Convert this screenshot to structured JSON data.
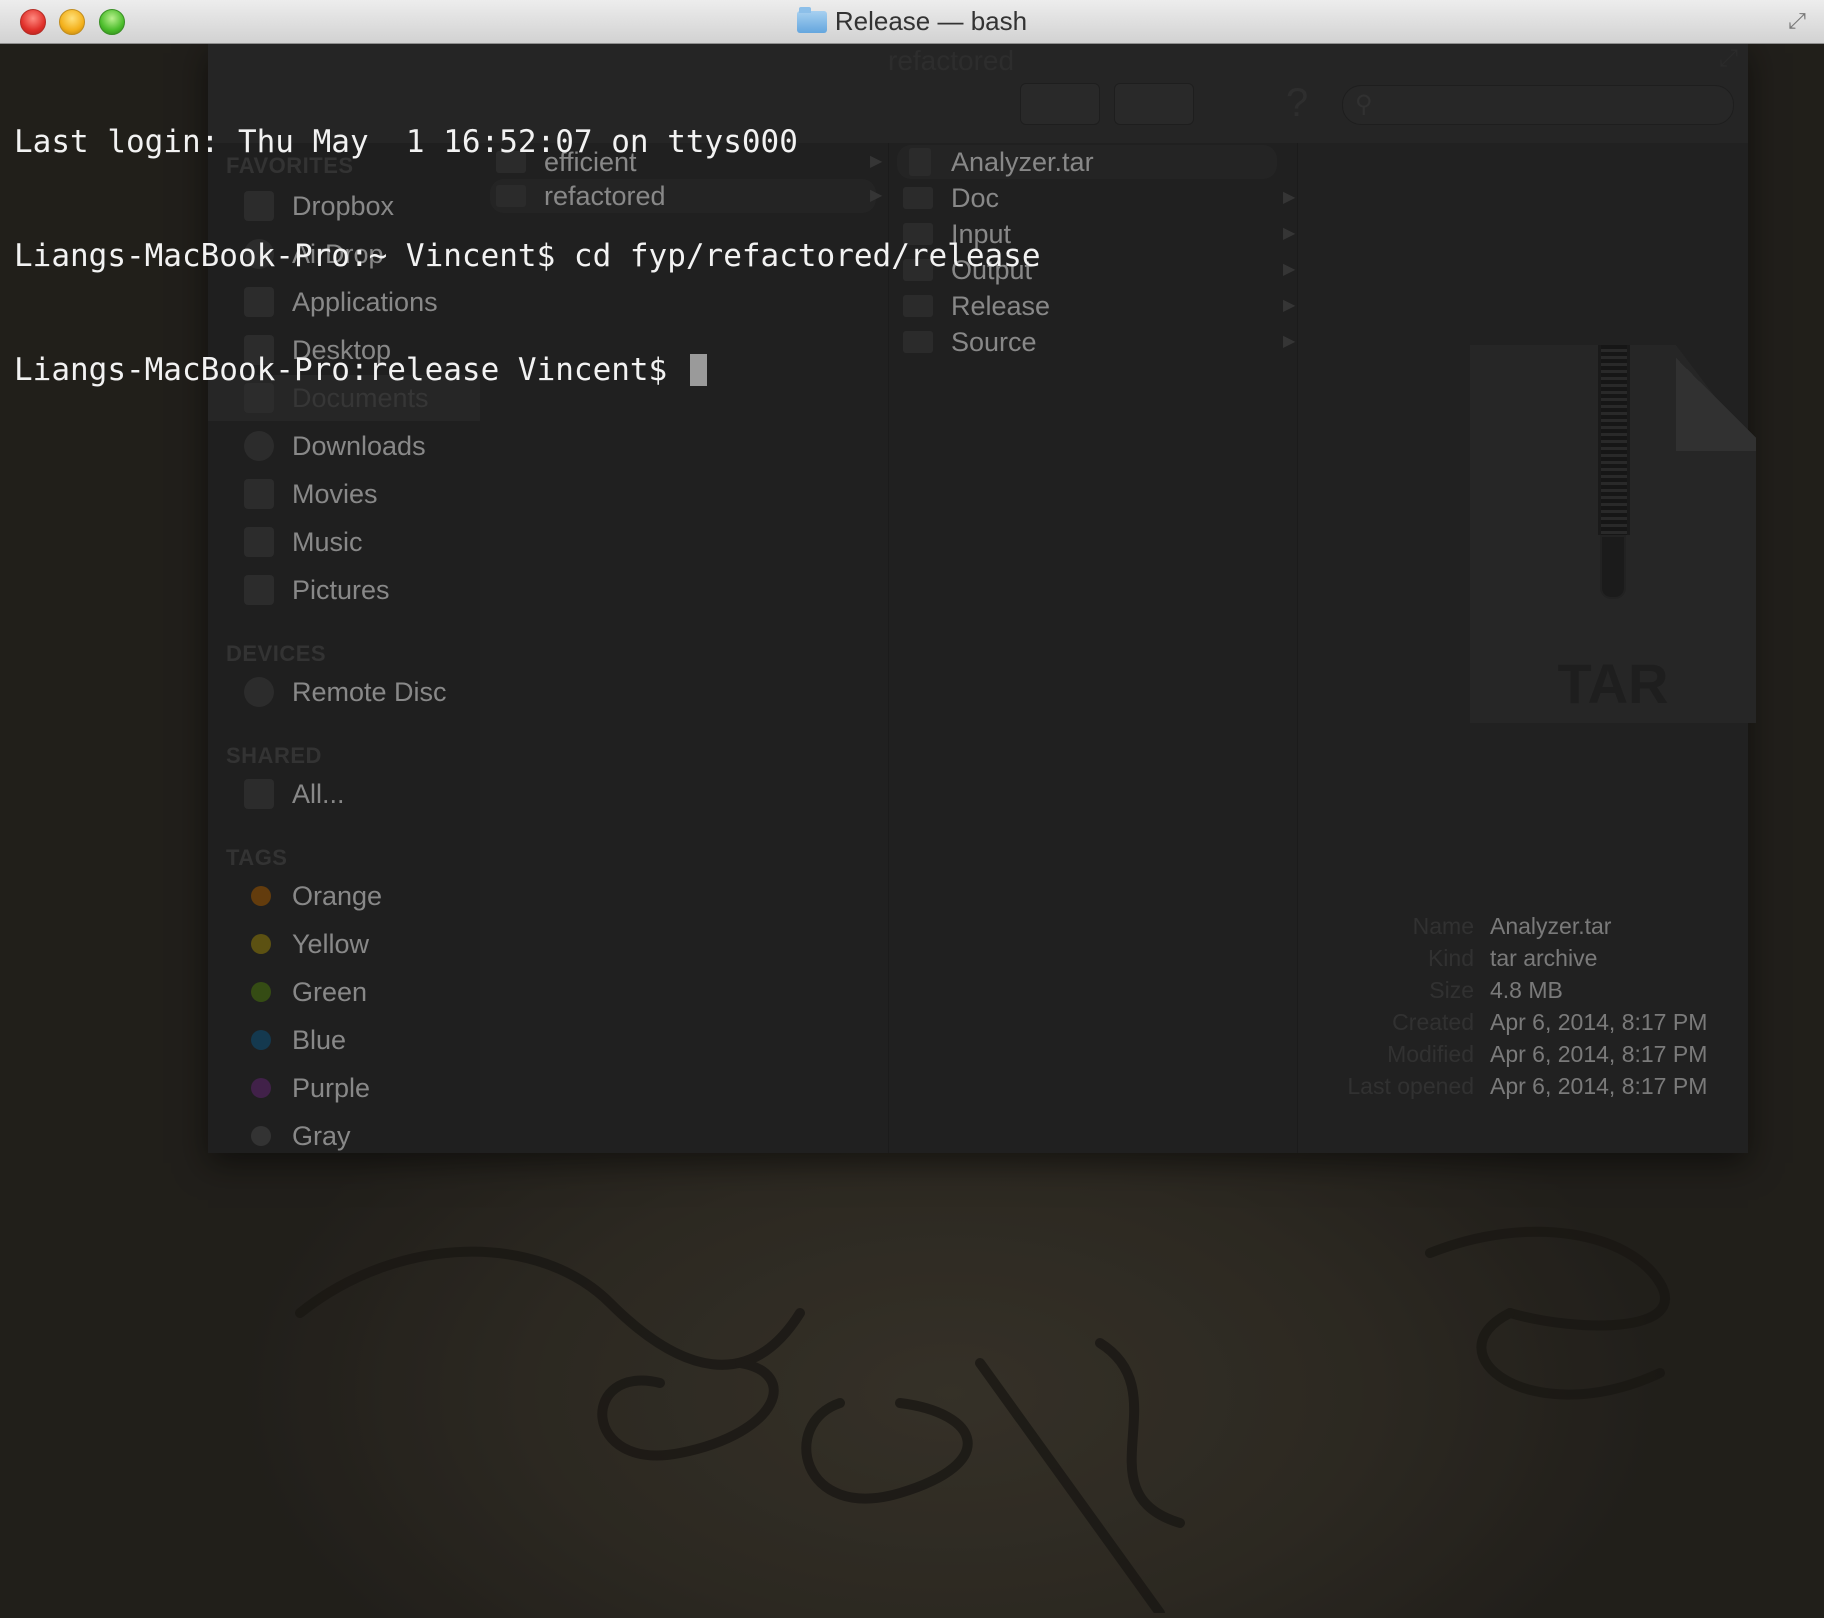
{
  "titlebar": {
    "title": "Release — bash"
  },
  "terminal": {
    "lines": [
      "Last login: Thu May  1 16:52:07 on ttys000",
      "Liangs-MacBook-Pro:~ Vincent$ cd fyp/refactored/release",
      "Liangs-MacBook-Pro:release Vincent$ "
    ]
  },
  "finder": {
    "title": "refactored",
    "sidebar": {
      "favorites_header": "FAVORITES",
      "favorites": [
        "Dropbox",
        "AirDrop",
        "Applications",
        "Desktop",
        "Documents",
        "Downloads",
        "Movies",
        "Music",
        "Pictures"
      ],
      "selected_favorite": "Documents",
      "devices_header": "DEVICES",
      "devices": [
        "Remote Disc"
      ],
      "shared_header": "SHARED",
      "shared": [
        "All..."
      ],
      "tags_header": "TAGS",
      "tags": [
        {
          "label": "Orange",
          "color": "#8a5412"
        },
        {
          "label": "Yellow",
          "color": "#80711a"
        },
        {
          "label": "Green",
          "color": "#4a6a1d"
        },
        {
          "label": "Blue",
          "color": "#1d4f6e"
        },
        {
          "label": "Purple",
          "color": "#5a2f66"
        },
        {
          "label": "Gray",
          "color": "#474747"
        }
      ]
    },
    "column1": [
      {
        "label": "efficient"
      },
      {
        "label": "refactored"
      }
    ],
    "column2": [
      {
        "label": "Analyzer.tar",
        "kind": "file"
      },
      {
        "label": "Doc",
        "kind": "folder"
      },
      {
        "label": "Input",
        "kind": "folder"
      },
      {
        "label": "Output",
        "kind": "folder"
      },
      {
        "label": "Release",
        "kind": "folder"
      },
      {
        "label": "Source",
        "kind": "folder"
      }
    ],
    "preview": {
      "icon_label": "TAR",
      "info": [
        {
          "key": "Name",
          "value": "Analyzer.tar"
        },
        {
          "key": "Kind",
          "value": "tar archive"
        },
        {
          "key": "Size",
          "value": "4.8 MB"
        },
        {
          "key": "Created",
          "value": "Apr 6, 2014, 8:17 PM"
        },
        {
          "key": "Modified",
          "value": "Apr 6, 2014, 8:17 PM"
        },
        {
          "key": "Last opened",
          "value": "Apr 6, 2014, 8:17 PM"
        }
      ]
    }
  },
  "icons": {
    "close": "close-button",
    "minimize": "minimize-button",
    "zoom": "zoom-button",
    "fullscreen": "fullscreen-icon",
    "folder": "folder-icon"
  }
}
